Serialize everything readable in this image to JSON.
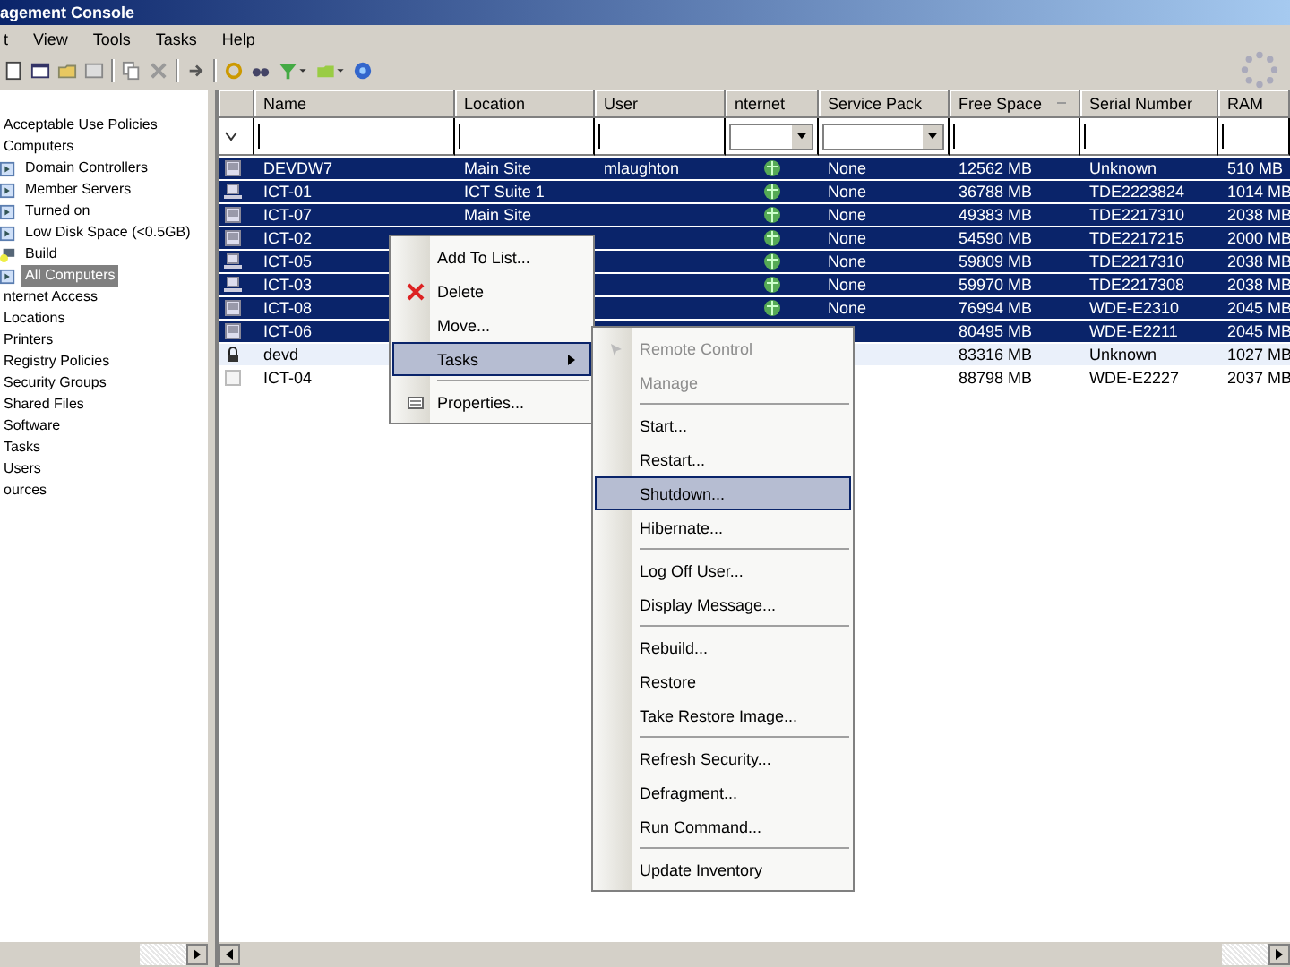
{
  "window": {
    "title": "agement Console"
  },
  "menu_bar": [
    "t",
    "View",
    "Tools",
    "Tasks",
    "Help"
  ],
  "tree": [
    {
      "label": "Acceptable Use Policies",
      "selected": false
    },
    {
      "label": "Computers",
      "selected": false,
      "children": [
        {
          "label": "Domain Controllers",
          "kind": "folder",
          "selected": false
        },
        {
          "label": "Member Servers",
          "kind": "folder",
          "selected": false
        },
        {
          "label": "Turned on",
          "kind": "folder",
          "selected": false
        },
        {
          "label": "Low Disk Space (<0.5GB)",
          "kind": "folder",
          "selected": false
        },
        {
          "label": "Build",
          "kind": "build",
          "selected": false
        },
        {
          "label": "All Computers",
          "kind": "folder",
          "selected": true
        }
      ]
    },
    {
      "label": "nternet Access",
      "selected": false
    },
    {
      "label": "Locations",
      "selected": false
    },
    {
      "label": "Printers",
      "selected": false
    },
    {
      "label": "Registry Policies",
      "selected": false
    },
    {
      "label": "Security Groups",
      "selected": false
    },
    {
      "label": "Shared Files",
      "selected": false
    },
    {
      "label": "Software",
      "selected": false
    },
    {
      "label": "Tasks",
      "selected": false
    },
    {
      "label": "Users",
      "selected": false
    },
    {
      "label": "ources",
      "selected": false
    }
  ],
  "table": {
    "columns": [
      "Name",
      "Location",
      "User",
      "nternet",
      "Service Pack",
      "Free Space",
      "Serial Number",
      "RAM"
    ],
    "rows": [
      {
        "kind": "monitor",
        "name": "DEVDW7",
        "location": "Main Site",
        "user": "mlaughton",
        "internet": true,
        "service_pack": "None",
        "free_space": "12562 MB",
        "serial": "Unknown",
        "ram": "510 MB",
        "selected": true,
        "focused": false
      },
      {
        "kind": "laptop",
        "name": "ICT-01",
        "location": "ICT Suite 1",
        "internet": true,
        "service_pack": "None",
        "free_space": "36788 MB",
        "serial": "TDE2223824",
        "ram": "1014 MB",
        "selected": true,
        "focused": false
      },
      {
        "kind": "monitor",
        "name": "ICT-07",
        "location": "Main Site",
        "internet": true,
        "service_pack": "None",
        "free_space": "49383 MB",
        "serial": "TDE2217310",
        "ram": "2038 MB",
        "selected": true,
        "focused": false
      },
      {
        "kind": "monitor",
        "name": "ICT-02",
        "internet": true,
        "service_pack": "None",
        "free_space": "54590 MB",
        "serial": "TDE2217215",
        "ram": "2000 MB",
        "selected": true,
        "focused": false
      },
      {
        "kind": "laptop",
        "name": "ICT-05",
        "internet": true,
        "service_pack": "None",
        "free_space": "59809 MB",
        "serial": "TDE2217310",
        "ram": "2038 MB",
        "selected": true,
        "focused": false
      },
      {
        "kind": "laptop",
        "name": "ICT-03",
        "internet": true,
        "service_pack": "None",
        "free_space": "59970 MB",
        "serial": "TDE2217308",
        "ram": "2038 MB",
        "selected": true,
        "focused": false
      },
      {
        "kind": "monitor",
        "name": "ICT-08",
        "internet": true,
        "service_pack": "None",
        "free_space": "76994 MB",
        "serial": "WDE-E2310",
        "ram": "2045 MB",
        "selected": true,
        "focused": false
      },
      {
        "kind": "monitor",
        "name": "ICT-06",
        "internet": false,
        "free_space": "80495 MB",
        "serial": "WDE-E2211",
        "ram": "2045 MB",
        "selected": true,
        "focused": false
      },
      {
        "kind": "lock",
        "name": "devd",
        "internet": false,
        "free_space": "83316 MB",
        "serial": "Unknown",
        "ram": "1027 MB",
        "selected": false,
        "focused": true
      },
      {
        "kind": "grey",
        "name": "ICT-04",
        "internet": false,
        "free_space": "88798 MB",
        "serial": "WDE-E2227",
        "ram": "2037 MB",
        "selected": false,
        "focused": false
      }
    ]
  },
  "context_menu": [
    {
      "kind": "item",
      "label": "Add To List...",
      "selected": false
    },
    {
      "kind": "delete",
      "label": "Delete",
      "selected": false
    },
    {
      "kind": "item",
      "label": "Move...",
      "selected": false
    },
    {
      "kind": "submenu",
      "label": "Tasks",
      "selected": true
    },
    {
      "kind": "separator"
    },
    {
      "kind": "properties",
      "label": "Properties...",
      "selected": false
    }
  ],
  "submenu": [
    {
      "kind": "remote",
      "label": "Remote Control",
      "disabled": true,
      "selected": false
    },
    {
      "kind": "item",
      "label": "Manage",
      "disabled": true,
      "selected": false
    },
    {
      "kind": "separator"
    },
    {
      "kind": "item",
      "label": "Start...",
      "disabled": false,
      "selected": false
    },
    {
      "kind": "item",
      "label": "Restart...",
      "disabled": false,
      "selected": false
    },
    {
      "kind": "item",
      "label": "Shutdown...",
      "disabled": false,
      "selected": true
    },
    {
      "kind": "item",
      "label": "Hibernate...",
      "disabled": false,
      "selected": false
    },
    {
      "kind": "separator"
    },
    {
      "kind": "item",
      "label": "Log Off User...",
      "disabled": false,
      "selected": false
    },
    {
      "kind": "item",
      "label": "Display Message...",
      "disabled": false,
      "selected": false
    },
    {
      "kind": "separator"
    },
    {
      "kind": "item",
      "label": "Rebuild...",
      "disabled": false,
      "selected": false
    },
    {
      "kind": "item",
      "label": "Restore",
      "disabled": false,
      "selected": false
    },
    {
      "kind": "item",
      "label": "Take Restore Image...",
      "disabled": false,
      "selected": false
    },
    {
      "kind": "separator"
    },
    {
      "kind": "item",
      "label": "Refresh Security...",
      "disabled": false,
      "selected": false
    },
    {
      "kind": "item",
      "label": "Defragment...",
      "disabled": false,
      "selected": false
    },
    {
      "kind": "item",
      "label": "Run Command...",
      "disabled": false,
      "selected": false
    },
    {
      "kind": "separator"
    },
    {
      "kind": "item",
      "label": "Update Inventory",
      "disabled": false,
      "selected": false
    }
  ]
}
